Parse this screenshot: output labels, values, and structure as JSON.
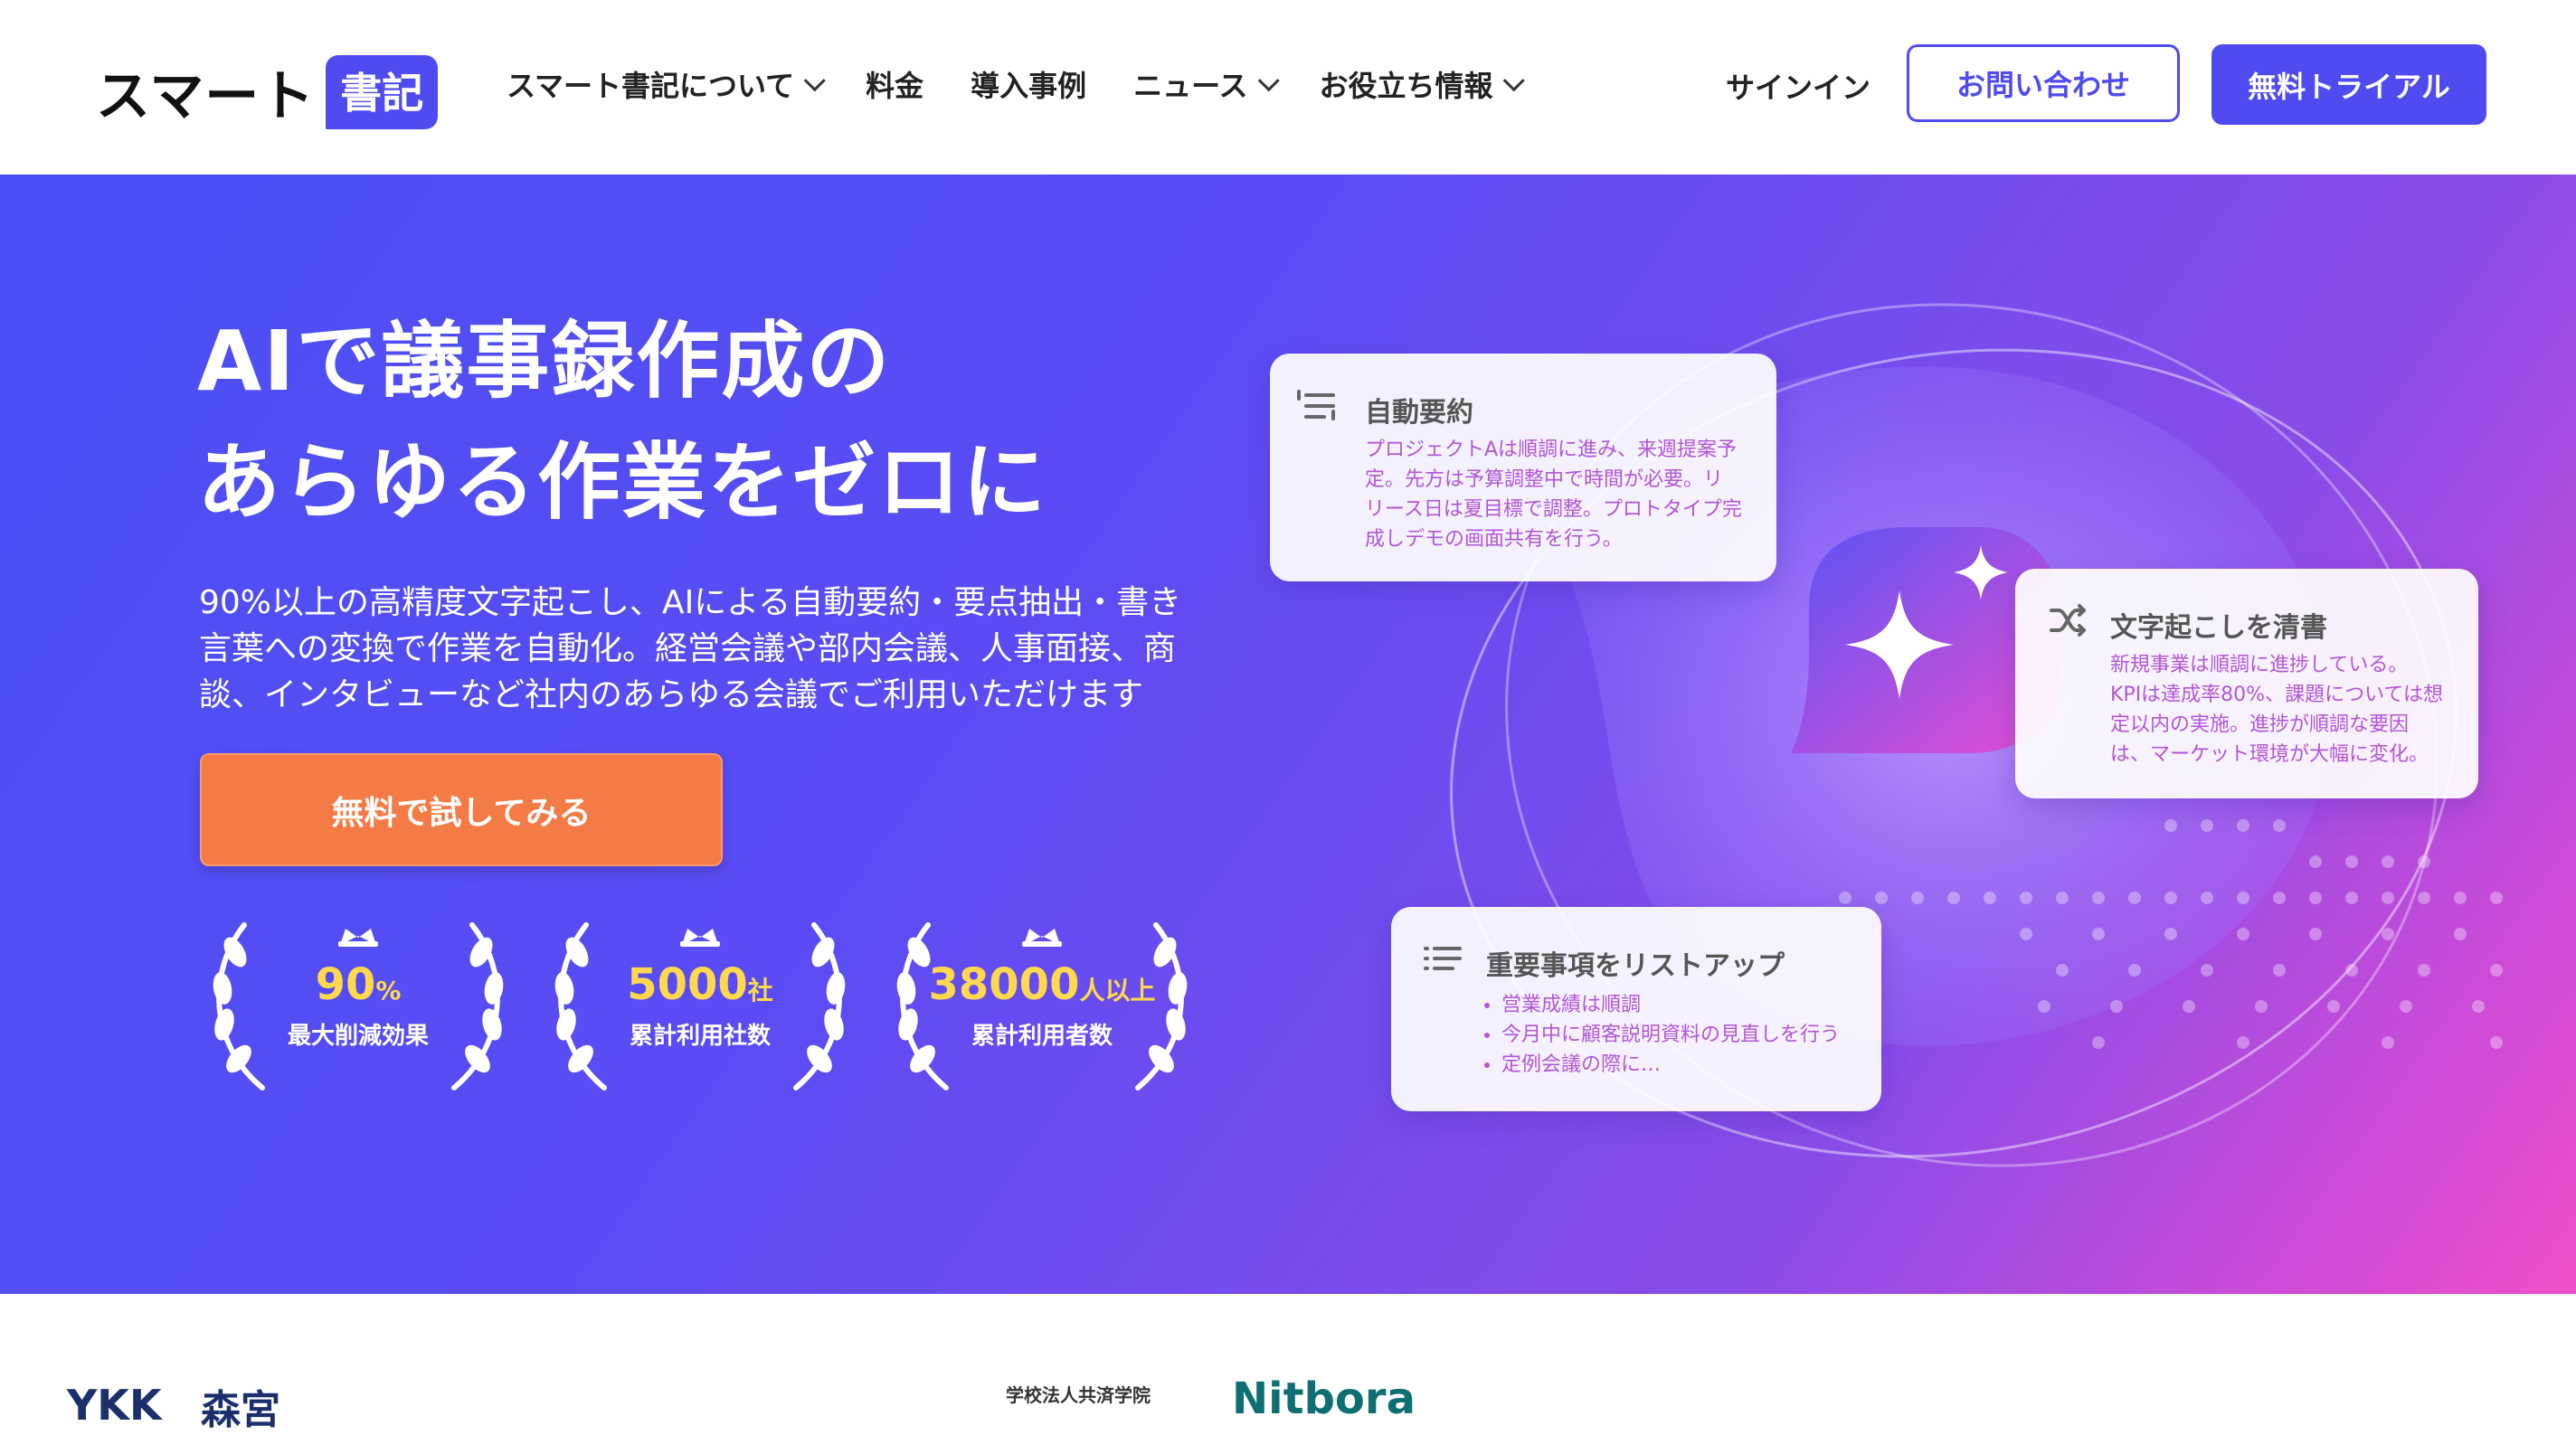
{
  "header": {
    "logo_text": "スマート",
    "logo_badge": "書記",
    "nav": [
      {
        "label": "スマート書記について",
        "dropdown": true
      },
      {
        "label": "料金",
        "dropdown": false
      },
      {
        "label": "導入事例",
        "dropdown": false
      },
      {
        "label": "ニュース",
        "dropdown": true
      },
      {
        "label": "お役立ち情報",
        "dropdown": true
      }
    ],
    "signin": "サインイン",
    "contact_button": "お問い合わせ",
    "trial_button": "無料トライアル"
  },
  "hero": {
    "title_line1": "AIで議事録作成の",
    "title_line2": "あらゆる作業をゼロに",
    "desc_line1": "90%以上の高精度文字起こし、AIによる自動要約・要点抽出・書き",
    "desc_line2": "言葉への変換で作業を自動化。経営会議や部内会議、人事面接、商",
    "desc_line3": "談、インタビューなど社内のあらゆる会議でご利用いただけます",
    "cta": "無料で試してみる",
    "stats": [
      {
        "value": "90",
        "unit": "%",
        "label": "最大削減効果"
      },
      {
        "value": "5000",
        "unit": "社",
        "label": "累計利用社数"
      },
      {
        "value": "38000",
        "unit": "人以上",
        "label": "累計利用者数"
      }
    ]
  },
  "cards": {
    "summary": {
      "title": "自動要約",
      "line1": "プロジェクトAは順調に進み、来週提案予",
      "line2": "定。先方は予算調整中で時間が必要。リ",
      "line3": "リース日は夏目標で調整。プロトタイプ完",
      "line4": "成しデモの画面共有を行う。"
    },
    "cleanup": {
      "title": "文字起こしを清書",
      "line1": "新規事業は順調に進捗している。",
      "line2": "KPIは達成率80%、課題については想",
      "line3": "定以内の実施。進捗が順調な要因",
      "line4": "は、マーケット環境が大幅に変化。"
    },
    "list": {
      "title": "重要事項をリストアップ",
      "items": [
        "営業成績は順調",
        "今月中に顧客説明資料の見直しを行う",
        "定例会議の際に…"
      ]
    }
  },
  "colors": {
    "brand": "#4f4bf0",
    "cta": "#f47b45",
    "stat_value": "#ffd84d",
    "card_text": "#b255d8"
  },
  "client_logos": [
    "YKK",
    "森宮",
    "学校法人共済学院",
    "Nitbora"
  ]
}
